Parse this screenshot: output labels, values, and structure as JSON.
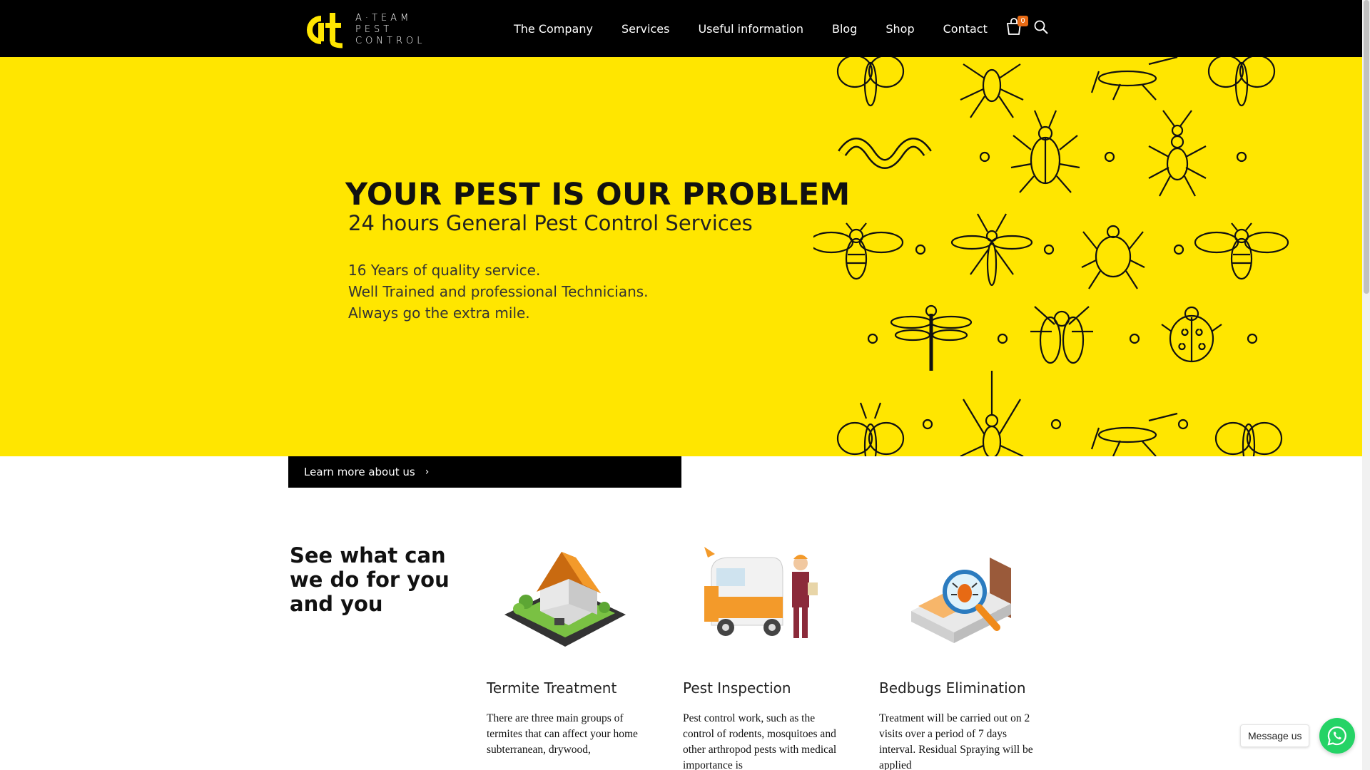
{
  "header": {
    "logo_lines": [
      "A·TEAM",
      "PEST",
      "CONTROL"
    ],
    "nav": [
      "The Company",
      "Services",
      "Useful information",
      "Blog",
      "Shop",
      "Contact"
    ],
    "cart_count": "0"
  },
  "hero": {
    "title": "YOUR PEST IS OUR PROBLEM",
    "subtitle": "24 hours General Pest Control Services",
    "lines": [
      "16 Years of quality service.",
      "Well Trained and professional Technicians.",
      "Always go the extra mile."
    ],
    "button_label": "Learn more about us"
  },
  "services": {
    "heading": "See what can we do for you and you",
    "items": [
      {
        "title": "Termite Treatment",
        "text": "There are three main groups of termites that can affect your home subterranean, drywood,"
      },
      {
        "title": "Pest Inspection",
        "text": "Pest control work, such as the control of rodents, mosquitoes and other arthropod pests with medical importance is"
      },
      {
        "title": "Bedbugs Elimination",
        "text": "Treatment will be carried out on 2 visits over a period of 7 days interval. Residual Spraying will be applied"
      }
    ]
  },
  "whatsapp": {
    "label": "Message us"
  },
  "colors": {
    "brand_yellow": "#ffe600",
    "header_black": "#000000",
    "badge_orange": "#e76a14",
    "whatsapp_green": "#25d366"
  },
  "icons": [
    "logo-mark-icon",
    "cart-icon",
    "search-icon",
    "chevron-right-icon",
    "whatsapp-icon",
    "insect-pattern-icon"
  ]
}
